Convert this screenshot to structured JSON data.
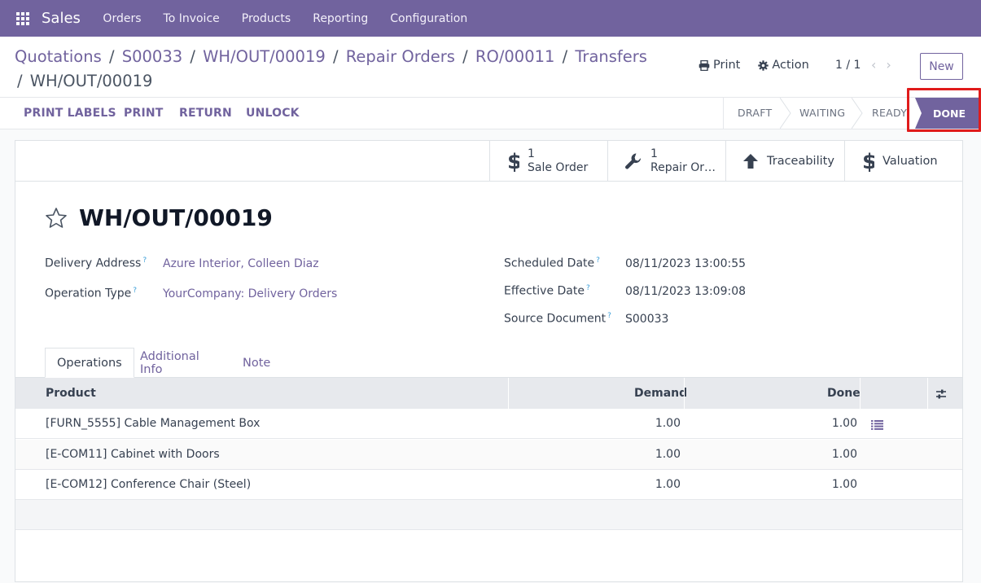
{
  "topnav": {
    "app_name": "Sales",
    "items": [
      "Orders",
      "To Invoice",
      "Products",
      "Reporting",
      "Configuration"
    ]
  },
  "breadcrumb": {
    "items": [
      "Quotations",
      "S00033",
      "WH/OUT/00019",
      "Repair Orders",
      "RO/00011",
      "Transfers"
    ],
    "current": "WH/OUT/00019"
  },
  "control": {
    "print_label": "Print",
    "action_label": "Action",
    "pager": "1 / 1",
    "new_label": "New"
  },
  "statusbar": {
    "buttons": [
      "PRINT LABELS",
      "PRINT",
      "RETURN",
      "UNLOCK"
    ],
    "stages": [
      "DRAFT",
      "WAITING",
      "READY",
      "DONE"
    ],
    "active_stage": "DONE"
  },
  "smart_buttons": {
    "sale_order": {
      "count": "1",
      "label": "Sale Order"
    },
    "repair_order": {
      "count": "1",
      "label": "Repair Or…"
    },
    "traceability": "Traceability",
    "valuation": "Valuation"
  },
  "record": {
    "title": "WH/OUT/00019",
    "delivery_address_label": "Delivery Address",
    "delivery_address": "Azure Interior, Colleen Diaz",
    "operation_type_label": "Operation Type",
    "operation_type": "YourCompany: Delivery Orders",
    "scheduled_date_label": "Scheduled Date",
    "scheduled_date": "08/11/2023 13:00:55",
    "effective_date_label": "Effective Date",
    "effective_date": "08/11/2023 13:09:08",
    "source_document_label": "Source Document",
    "source_document": "S00033",
    "help_mark": "?"
  },
  "tabs": [
    "Operations",
    "Additional Info",
    "Note"
  ],
  "table": {
    "headers": {
      "product": "Product",
      "demand": "Demand",
      "done": "Done"
    },
    "rows": [
      {
        "product": "[FURN_5555] Cable Management Box",
        "demand": "1.00",
        "done": "1.00"
      },
      {
        "product": "[E-COM11] Cabinet with Doors",
        "demand": "1.00",
        "done": "1.00"
      },
      {
        "product": "[E-COM12] Conference Chair (Steel)",
        "demand": "1.00",
        "done": "1.00"
      }
    ]
  },
  "colors": {
    "brand": "#71639e",
    "highlight": "#e01b1b"
  }
}
